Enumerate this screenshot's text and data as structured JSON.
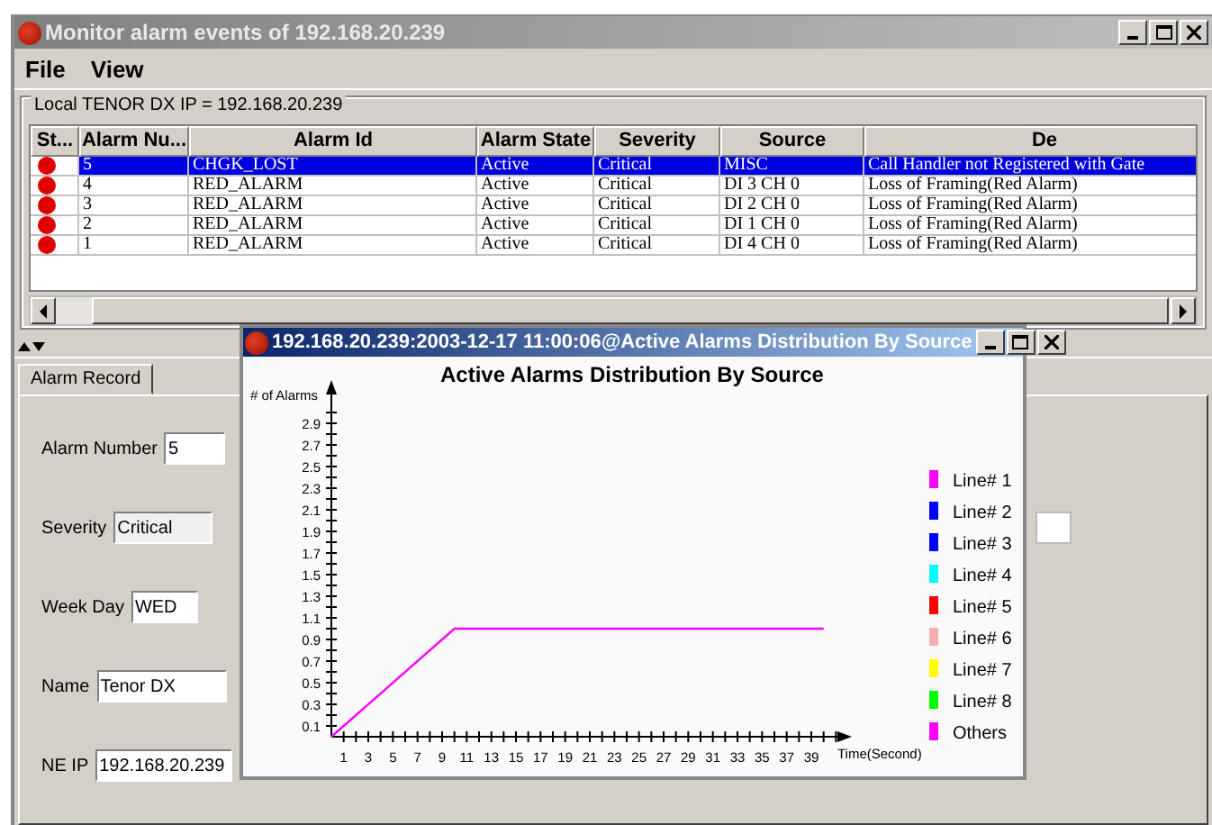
{
  "window": {
    "title": "Monitor alarm events of 192.168.20.239"
  },
  "menu": [
    "File",
    "View"
  ],
  "group": {
    "title": "Local TENOR DX IP = 192.168.20.239"
  },
  "table": {
    "columns": [
      "St...",
      "Alarm Nu...",
      "Alarm Id",
      "Alarm State",
      "Severity",
      "Source",
      "De"
    ],
    "rows": [
      {
        "selected": true,
        "cells": [
          "",
          "5",
          "CHGK_LOST",
          "Active",
          "Critical",
          "MISC",
          "Call Handler not Registered with Gate"
        ]
      },
      {
        "selected": false,
        "cells": [
          "",
          "4",
          "RED_ALARM",
          "Active",
          "Critical",
          "DI 3 CH 0",
          "Loss of Framing(Red Alarm)"
        ]
      },
      {
        "selected": false,
        "cells": [
          "",
          "3",
          "RED_ALARM",
          "Active",
          "Critical",
          "DI 2 CH 0",
          "Loss of Framing(Red Alarm)"
        ]
      },
      {
        "selected": false,
        "cells": [
          "",
          "2",
          "RED_ALARM",
          "Active",
          "Critical",
          "DI 1 CH 0",
          "Loss of Framing(Red Alarm)"
        ]
      },
      {
        "selected": false,
        "cells": [
          "",
          "1",
          "RED_ALARM",
          "Active",
          "Critical",
          "DI 4 CH 0",
          "Loss of Framing(Red Alarm)"
        ]
      }
    ]
  },
  "tabs": [
    {
      "label": "Alarm Record",
      "selected": true
    }
  ],
  "form": [
    {
      "label": "Alarm Number",
      "value": "5"
    },
    {
      "label": "Severity",
      "value": "Critical"
    },
    {
      "label": "Week Day",
      "value": "WED"
    },
    {
      "label": "Name",
      "value": "Tenor DX"
    },
    {
      "label": "NE IP",
      "value": "192.168.20.239"
    }
  ],
  "chart_window": {
    "title": "192.168.20.239:2003-12-17 11:00:06@Active Alarms Distribution By Source",
    "chart_data": {
      "type": "line",
      "title": "Active Alarms Distribution By Source",
      "xlabel": "Time(Second)",
      "ylabel": "# of Alarms",
      "x": [
        0,
        10,
        40
      ],
      "series": [
        {
          "name": "Line# 1",
          "color": "#ff00ff",
          "values": [
            0,
            1,
            1
          ]
        }
      ],
      "xlim": [
        0,
        42
      ],
      "ylim": [
        0,
        3.2
      ],
      "xticks": [
        1,
        3,
        5,
        7,
        9,
        11,
        13,
        15,
        17,
        19,
        21,
        23,
        25,
        27,
        29,
        31,
        33,
        35,
        37,
        39
      ],
      "yticks": [
        0.1,
        0.3,
        0.5,
        0.7,
        0.9,
        1.1,
        1.3,
        1.5,
        1.7,
        1.9,
        2.1,
        2.3,
        2.5,
        2.7,
        2.9
      ]
    },
    "legend": [
      {
        "label": "Line# 2",
        "color": "#0000ff"
      },
      {
        "label": "Line# 3",
        "color": "#0000ff"
      },
      {
        "label": "Line# 4",
        "color": "#00ffff"
      },
      {
        "label": "Line# 5",
        "color": "#ff0000"
      },
      {
        "label": "Line# 6",
        "color": "#f4b0b0"
      },
      {
        "label": "Line# 7",
        "color": "#ffff00"
      },
      {
        "label": "Line# 8",
        "color": "#00ff00"
      },
      {
        "label": "Others",
        "color": "#ff00ff"
      }
    ]
  }
}
